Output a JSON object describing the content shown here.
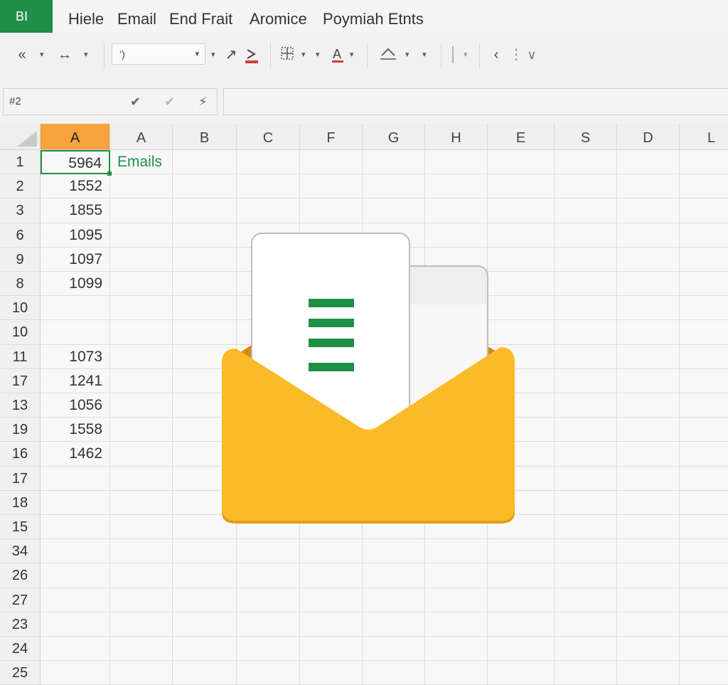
{
  "app": {
    "badge": "BI"
  },
  "menu": [
    "Hiele",
    "Email",
    "End Frait",
    "Aromice",
    "Poymiah Etnts"
  ],
  "toolbar": {
    "font_value": "‘)",
    "icons": [
      "undo-icon",
      "redo-icon",
      "font-dropdown",
      "format-painter-icon",
      "font-color-icon",
      "borders-icon",
      "text-color-icon",
      "fill-icon",
      "align-icon",
      "merge-icon",
      "sort-icon",
      "filter-icon"
    ]
  },
  "formula_bar": {
    "name_box": "#2",
    "formula": ""
  },
  "grid": {
    "columns": [
      "A",
      "A",
      "B",
      "C",
      "F",
      "G",
      "H",
      "E",
      "S",
      "D",
      "L"
    ],
    "active_column_index": 0,
    "rows": [
      "1",
      "2",
      "3",
      "6",
      "9",
      "8",
      "10",
      "10",
      "11",
      "17",
      "13",
      "19",
      "16",
      "17",
      "18",
      "15",
      "34",
      "26",
      "27",
      "23",
      "24",
      "25"
    ],
    "col_a_values": [
      "5964",
      "1552",
      "1855",
      "1095",
      "1097",
      "1099",
      "",
      "",
      "1073",
      "1241",
      "1056",
      "1558",
      "1462"
    ],
    "label_cell": "Emails",
    "selected_cell_value": "5964"
  },
  "colors": {
    "accent_green": "#1f8f46",
    "active_header_orange": "#f7a23a",
    "envelope_yellow": "#fbba27",
    "envelope_shadow": "#e89a12"
  },
  "illustration": {
    "icon": "envelope-with-document-icon"
  }
}
